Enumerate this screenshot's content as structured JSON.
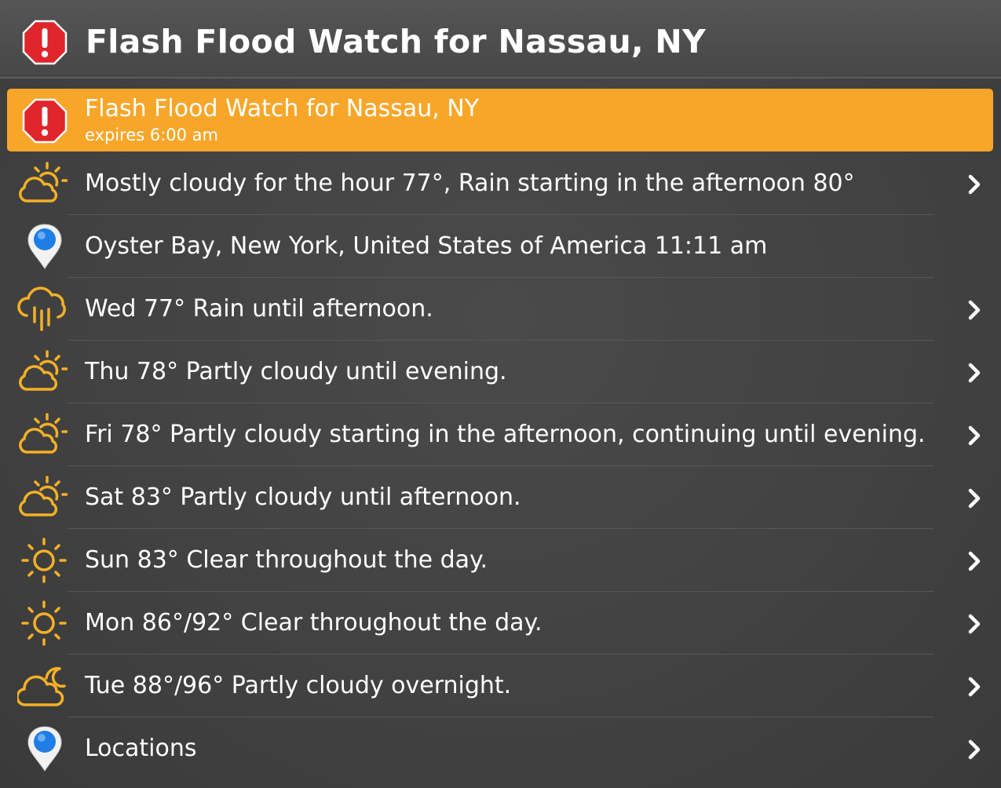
{
  "header": {
    "title": "Flash Flood Watch for Nassau, NY",
    "icon": "stop-alert-icon"
  },
  "alert": {
    "title": "Flash Flood Watch for Nassau, NY",
    "subtitle": "expires 6:00 am",
    "color": "#f8a62a",
    "icon": "stop-alert-icon"
  },
  "rows": [
    {
      "label": "Mostly cloudy for the hour 77°, Rain starting in the afternoon 80°",
      "icon": "partly-cloudy-icon",
      "chevron": true
    },
    {
      "label": "Oyster Bay, New York, United States of America 11:11 am",
      "icon": "location-pin-icon",
      "chevron": false
    },
    {
      "label": "Wed 77° Rain until afternoon.",
      "icon": "rain-icon",
      "chevron": true
    },
    {
      "label": "Thu 78° Partly cloudy until evening.",
      "icon": "partly-cloudy-icon",
      "chevron": true
    },
    {
      "label": "Fri 78° Partly cloudy starting in the afternoon, continuing until evening.",
      "icon": "partly-cloudy-icon",
      "chevron": true
    },
    {
      "label": "Sat 83° Partly cloudy until afternoon.",
      "icon": "partly-cloudy-icon",
      "chevron": true
    },
    {
      "label": "Sun 83° Clear throughout the day.",
      "icon": "sun-icon",
      "chevron": true
    },
    {
      "label": "Mon 86°/92° Clear throughout the day.",
      "icon": "sun-icon",
      "chevron": true
    },
    {
      "label": "Tue 88°/96° Partly cloudy overnight.",
      "icon": "partly-cloudy-night-icon",
      "chevron": true
    },
    {
      "label": "Locations",
      "icon": "location-pin-icon",
      "chevron": true
    }
  ],
  "colors": {
    "accent": "#f8a62a",
    "icon_yellow": "#f5b025",
    "alert_red": "#e0252b",
    "pin_blue": "#1f7de6"
  }
}
